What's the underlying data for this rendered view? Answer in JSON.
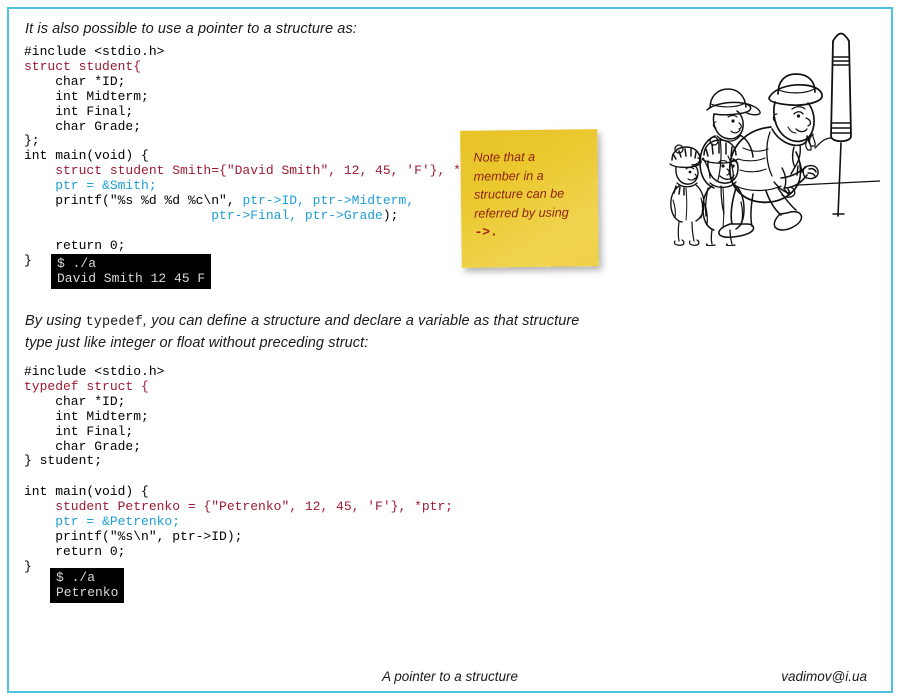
{
  "frame": {
    "border_color": "#4ec3e0"
  },
  "intro": {
    "text": "It is also possible to use a pointer to a structure as:"
  },
  "code_block_1": {
    "lines": [
      [
        {
          "t": "#include <stdio.h>",
          "c": "black"
        }
      ],
      [
        {
          "t": "struct student{",
          "c": "red"
        }
      ],
      [
        {
          "t": "    char *ID;",
          "c": "black"
        }
      ],
      [
        {
          "t": "    int Midterm;",
          "c": "black"
        }
      ],
      [
        {
          "t": "    int Final;",
          "c": "black"
        }
      ],
      [
        {
          "t": "    char Grade;",
          "c": "black"
        }
      ],
      [
        {
          "t": "};",
          "c": "black"
        }
      ],
      [
        {
          "t": "int main(void) {",
          "c": "black"
        }
      ],
      [
        {
          "t": "    struct student Smith={\"David Smith\", 12, 45, 'F'}, *ptr;",
          "c": "red"
        }
      ],
      [
        {
          "t": "    ptr = &Smith;",
          "c": "blue"
        }
      ],
      [
        {
          "t": "    printf(\"%s %d %d %c\\n\", ",
          "c": "black"
        },
        {
          "t": "ptr->ID, ptr->Midterm,",
          "c": "blue"
        }
      ],
      [
        {
          "t": "                        ",
          "c": "black"
        },
        {
          "t": "ptr->Final, ptr->Grade",
          "c": "blue"
        },
        {
          "t": ");",
          "c": "black"
        }
      ],
      [
        {
          "t": "",
          "c": "black"
        }
      ],
      [
        {
          "t": "    return 0;",
          "c": "black"
        }
      ],
      [
        {
          "t": "}",
          "c": "black"
        }
      ]
    ]
  },
  "terminal_1": {
    "command": "$ ./a",
    "output": "David Smith 12 45 F"
  },
  "sticky_note": {
    "line_1": "Note that a",
    "line_2": "member in a",
    "line_3": "structure can be",
    "line_4": "referred by using",
    "arrow": "->.",
    "background_color": "#eac82e",
    "text_color": "#8d2410"
  },
  "illustration": {
    "name": "man-lighting-firework-rocket-with-children",
    "description": "Line-art cartoon: a heavy-set man in a hat and scarf bends over to light a large firework rocket on a stand while three children in hats crouch behind him."
  },
  "typedef_para": {
    "before": "By using ",
    "mono": "typedef",
    "after": ", you can define a structure and declare a variable as that structure type just like integer or float without preceding struct:"
  },
  "code_block_2": {
    "lines": [
      [
        {
          "t": "#include <stdio.h>",
          "c": "black"
        }
      ],
      [
        {
          "t": "typedef struct {",
          "c": "red"
        }
      ],
      [
        {
          "t": "    char *ID;",
          "c": "black"
        }
      ],
      [
        {
          "t": "    int Midterm;",
          "c": "black"
        }
      ],
      [
        {
          "t": "    int Final;",
          "c": "black"
        }
      ],
      [
        {
          "t": "    char Grade;",
          "c": "black"
        }
      ],
      [
        {
          "t": "} student;",
          "c": "black"
        }
      ]
    ]
  },
  "code_block_3": {
    "lines": [
      [
        {
          "t": "int main(void) {",
          "c": "black"
        }
      ],
      [
        {
          "t": "    student Petrenko = {\"Petrenko\", 12, 45, 'F'}, *ptr;",
          "c": "red"
        }
      ],
      [
        {
          "t": "    ptr = &Petrenko;",
          "c": "blue"
        }
      ],
      [
        {
          "t": "    printf(\"%s\\n\", ptr->ID);",
          "c": "black"
        }
      ],
      [
        {
          "t": "    return 0;",
          "c": "black"
        }
      ],
      [
        {
          "t": "}",
          "c": "black"
        }
      ]
    ]
  },
  "terminal_2": {
    "command": "$ ./a",
    "output": "Petrenko"
  },
  "footer": {
    "title": "A pointer to a structure",
    "email": "vadimov@i.ua"
  },
  "colors": {
    "code_black": "#000000",
    "code_red": "#9e1b32",
    "code_blue": "#1f9fd8",
    "terminal_bg": "#000000",
    "terminal_fg": "#d8d8d8"
  }
}
